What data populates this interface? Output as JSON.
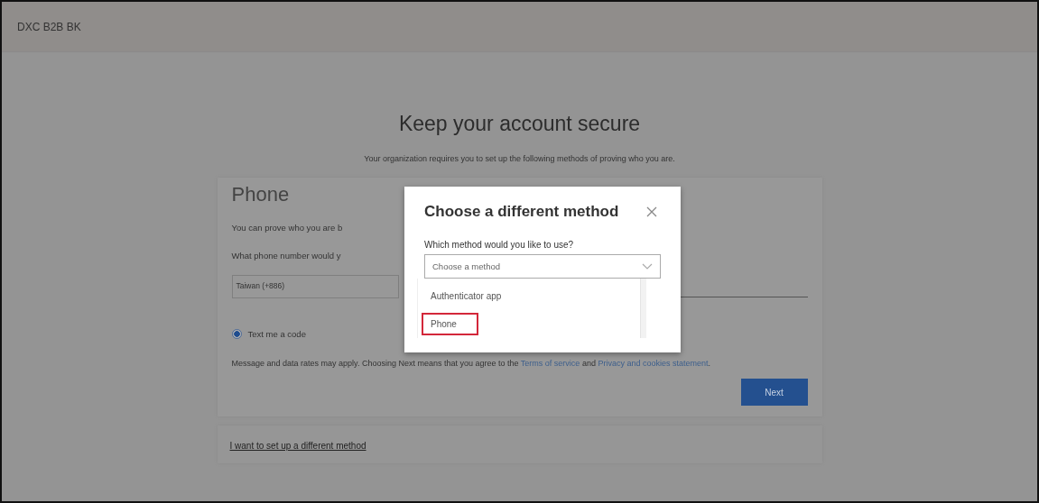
{
  "header": {
    "title": "DXC B2B BK"
  },
  "page": {
    "title": "Keep your account secure",
    "subtitle": "Your organization requires you to set up the following methods of proving who you are."
  },
  "card": {
    "title": "Phone",
    "intro": "You can prove who you are b",
    "question": "What phone number would y",
    "country": "Taiwan (+886)",
    "options": [
      {
        "label": "Text me a code",
        "selected": true
      }
    ],
    "notice": {
      "before": "Message and data rates may apply. Choosing Next means that you agree to the ",
      "terms": "Terms of service",
      "middle": " and ",
      "privacy": "Privacy and cookies statement",
      "after": "."
    },
    "next_button": "Next"
  },
  "alternate_link": "I want to set up a different method",
  "dialog": {
    "title": "Choose a different method",
    "label": "Which method would you like to use?",
    "select": {
      "placeholder": "Choose a method"
    },
    "items": [
      {
        "label": "Authenticator app",
        "selected": false
      },
      {
        "label": "Phone",
        "selected": true
      }
    ]
  }
}
